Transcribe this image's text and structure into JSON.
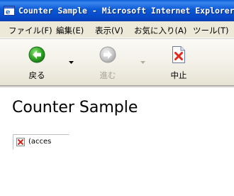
{
  "window": {
    "title": "Counter Sample - Microsoft Internet Explorer"
  },
  "menubar": {
    "items": [
      "ファイル(F)",
      "編集(E)",
      "表示(V)",
      "お気に入り(A)",
      "ツール(T)"
    ]
  },
  "toolbar": {
    "back_label": "戻る",
    "forward_label": "進む",
    "stop_label": "中止"
  },
  "page": {
    "heading": "Counter Sample",
    "broken_image_alt": "(acces"
  }
}
